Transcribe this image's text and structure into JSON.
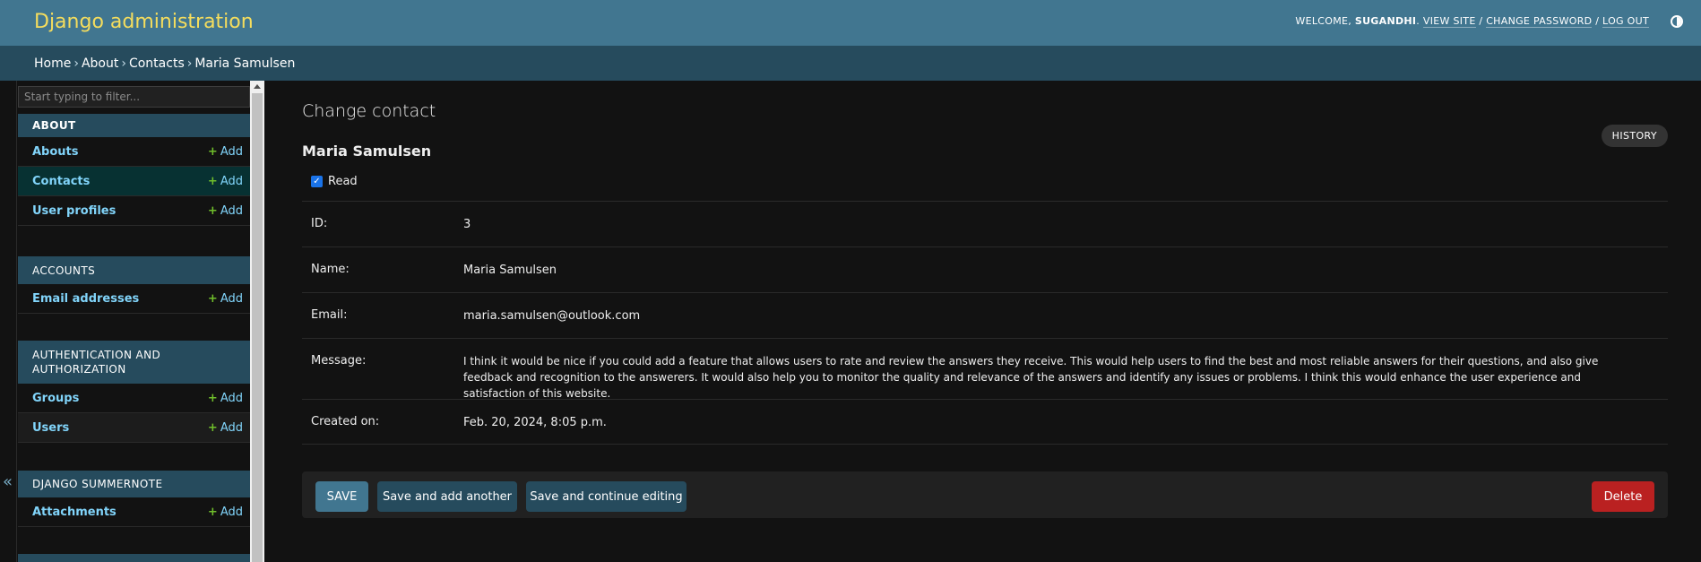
{
  "header": {
    "brand": "Django administration",
    "welcome": "WELCOME,",
    "username": "SUGANDHI",
    "view_site": "VIEW SITE",
    "change_password": "CHANGE PASSWORD",
    "log_out": "LOG OUT",
    "separator": "/"
  },
  "breadcrumbs": {
    "items": [
      "Home",
      "About",
      "Contacts"
    ],
    "current": "Maria Samulsen",
    "separator": "›"
  },
  "sidebar": {
    "filter_placeholder": "Start typing to filter...",
    "collapse_glyph": "«",
    "add_label": "Add",
    "modules": [
      {
        "caption": "ABOUT",
        "models": [
          "Abouts",
          "Contacts",
          "User profiles"
        ]
      },
      {
        "caption": "ACCOUNTS",
        "models": [
          "Email addresses"
        ]
      },
      {
        "caption": "AUTHENTICATION AND AUTHORIZATION",
        "models": [
          "Groups",
          "Users"
        ]
      },
      {
        "caption": "DJANGO SUMMERNOTE",
        "models": [
          "Attachments"
        ]
      }
    ]
  },
  "main": {
    "title": "Change contact",
    "history": "HISTORY",
    "object_name": "Maria Samulsen",
    "read_label": "Read",
    "read_checked": true,
    "fields": [
      {
        "label": "ID:",
        "value": "3"
      },
      {
        "label": "Name:",
        "value": "Maria Samulsen"
      },
      {
        "label": "Email:",
        "value": "maria.samulsen@outlook.com"
      },
      {
        "label": "Message:",
        "value": "I think it would be nice if you could add a feature that allows users to rate and review the answers they receive. This would help users to find the best and most reliable answers for their questions, and also give feedback and recognition to the answerers. It would also help you to monitor the quality and relevance of the answers and identify any issues or problems. I think this would enhance the user experience and satisfaction of this website."
      },
      {
        "label": "Created on:",
        "value": "Feb. 20, 2024, 8:05 p.m."
      }
    ]
  },
  "submit_row": {
    "save": "SAVE",
    "save_add_another": "Save and add another",
    "save_continue": "Save and continue editing",
    "delete": "Delete"
  },
  "colors": {
    "header_bg": "#417690",
    "breadcrumb_bg": "#264b5d",
    "brand": "#f5dd5d",
    "link": "#81d4fa",
    "add_plus": "#70bf2b",
    "delete": "#ba2121",
    "background": "#121212"
  }
}
